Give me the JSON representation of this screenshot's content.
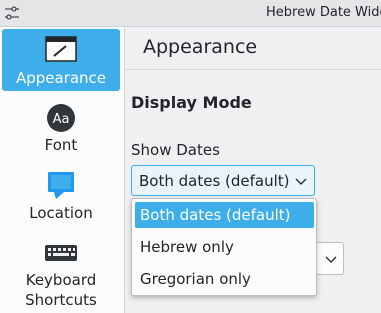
{
  "window": {
    "title": "Hebrew Date Widg",
    "menu_icon": "hamburger-settings-icon"
  },
  "sidebar": {
    "items": [
      {
        "label": "Appearance",
        "icon": "appearance-icon",
        "selected": true
      },
      {
        "label": "Font",
        "icon": "font-icon",
        "icon_text": "Aa",
        "selected": false
      },
      {
        "label": "Location",
        "icon": "location-icon",
        "selected": false
      },
      {
        "label": "Keyboard",
        "label2": "Shortcuts",
        "icon": "keyboard-icon",
        "selected": false
      }
    ]
  },
  "page": {
    "title": "Appearance"
  },
  "display_mode": {
    "heading": "Display Mode",
    "show_dates_label": "Show Dates",
    "show_dates_value": "Both dates (default)",
    "options": [
      "Both dates (default)",
      "Hebrew only",
      "Gregorian only"
    ],
    "selected_index": 0
  },
  "colors": {
    "accent": "#3daee9",
    "window_bg": "#eff0f1",
    "sidebar_bg": "#fcfcfc"
  }
}
